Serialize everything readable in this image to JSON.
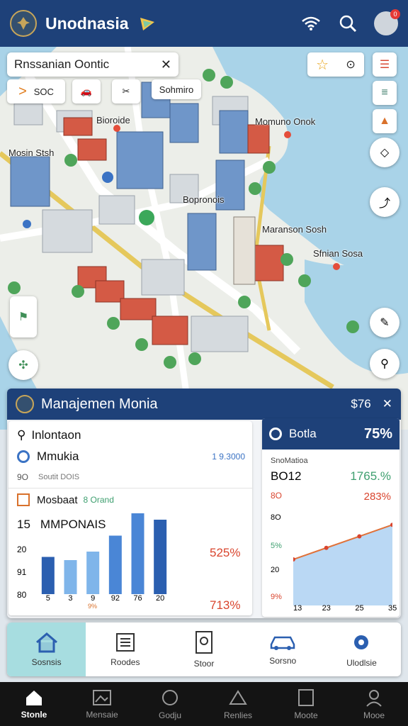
{
  "header": {
    "title": "Unodnasia"
  },
  "search": {
    "value": "Rnssanian Oontic"
  },
  "chips": {
    "first": "SOC",
    "second": "Sohmiro"
  },
  "map_labels": [
    "Bioroide",
    "Momuno Onok",
    "Mosin Stsh",
    "Bopronois",
    "Maranson Sosh",
    "Sfnian Sosa"
  ],
  "panel": {
    "title": "Manajemen Monia",
    "price": "$76",
    "left": {
      "item1": "Inlontaon",
      "item2": "Mmukia",
      "item2_value": "1 9.3000",
      "sub_num": "9O",
      "sub_text": "Soutit DOIS",
      "item3": "Mosbaat",
      "item3_badge": "8 Orand",
      "count": "15",
      "heading": "MMPONAIS",
      "y_ticks": [
        "20",
        "91",
        "80"
      ],
      "x_labels": [
        "5",
        "3",
        "9",
        "92",
        "76",
        "20"
      ],
      "x_note": "9%",
      "pct1": "525%",
      "pct2": "713%"
    },
    "right": {
      "title": "Botla",
      "pct": "75%",
      "sub": "SnoMatioa",
      "code": "BO12",
      "green_val": "1765.%",
      "label_80": "8O",
      "red_val": "283%",
      "label_8": "8O",
      "label_5": "5%",
      "label_20": "20",
      "label_9": "9%",
      "x_labels": [
        "13",
        "23",
        "25",
        "35"
      ]
    }
  },
  "chart_data": [
    {
      "type": "bar",
      "categories": [
        "5",
        "3",
        "9",
        "92",
        "76",
        "20"
      ],
      "series": [
        {
          "values": [
            35,
            32,
            40,
            55,
            76,
            70
          ]
        }
      ]
    },
    {
      "type": "line",
      "x": [
        "13",
        "23",
        "25",
        "35"
      ],
      "series": [
        {
          "values": [
            4,
            5,
            6,
            7
          ]
        }
      ]
    }
  ],
  "tabs": [
    "Sosnsis",
    "Roodes",
    "Stoor",
    "Sorsno",
    "Ulodlsie"
  ],
  "nav": [
    "Stonle",
    "Mensaie",
    "Godju",
    "Renlies",
    "Moote",
    "Mooe"
  ],
  "colors": {
    "primary": "#1e4179",
    "accent": "#a7dde0"
  }
}
